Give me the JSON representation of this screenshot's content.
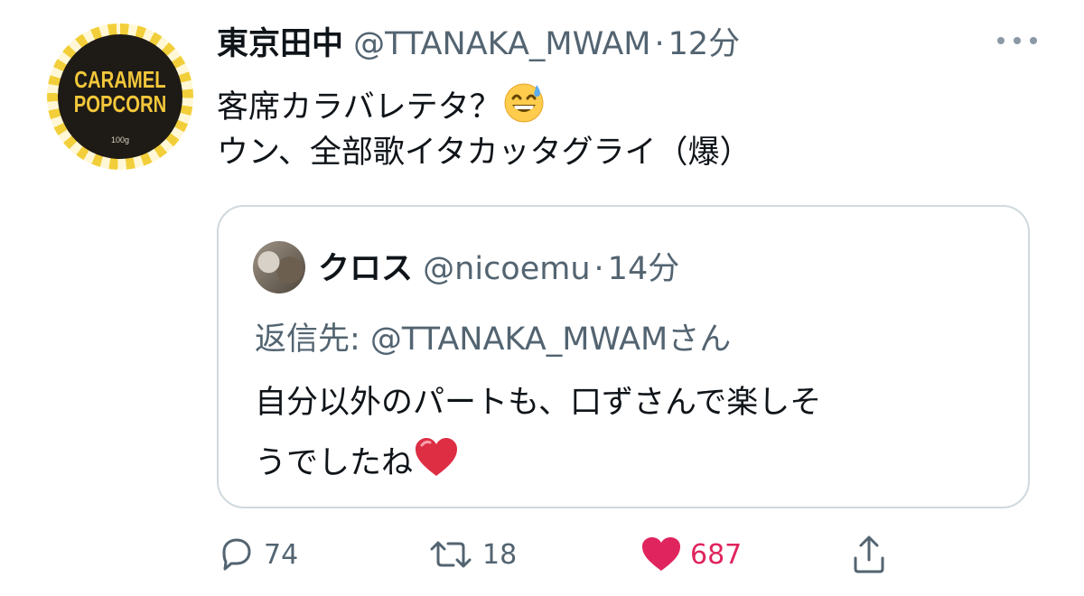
{
  "tweet": {
    "display_name": "東京田中",
    "handle": "@TTANAKA_MWAM",
    "separator": "·",
    "time": "12分",
    "more_icon": "more-horizontal-icon",
    "avatar": {
      "line1": "CARAMEL",
      "line2": "POPCORN",
      "size_text": "100g"
    },
    "body_line1": "客席カラバレテタ？",
    "body_line1_emoji": "grinning-sweat-emoji",
    "body_line2": "ウン、全部歌イタカッタグライ（爆）"
  },
  "quote": {
    "display_name": "クロス",
    "handle": "@nicoemu",
    "separator": "·",
    "time": "14分",
    "reply_to": "返信先: @TTANAKA_MWAMさん",
    "text_line1": "自分以外のパートも、口ずさんで楽しそ",
    "text_line2": "うでしたね",
    "text_line2_emoji": "red-heart-emoji"
  },
  "actions": {
    "reply": {
      "icon": "reply-icon",
      "count": "74"
    },
    "retweet": {
      "icon": "retweet-icon",
      "count": "18"
    },
    "like": {
      "icon": "heart-icon",
      "count": "687",
      "color": "#e0245e"
    },
    "share": {
      "icon": "share-icon"
    }
  },
  "colors": {
    "text": "#0f1419",
    "secondary": "#536471",
    "border": "#cfd9de",
    "like": "#e0245e"
  }
}
